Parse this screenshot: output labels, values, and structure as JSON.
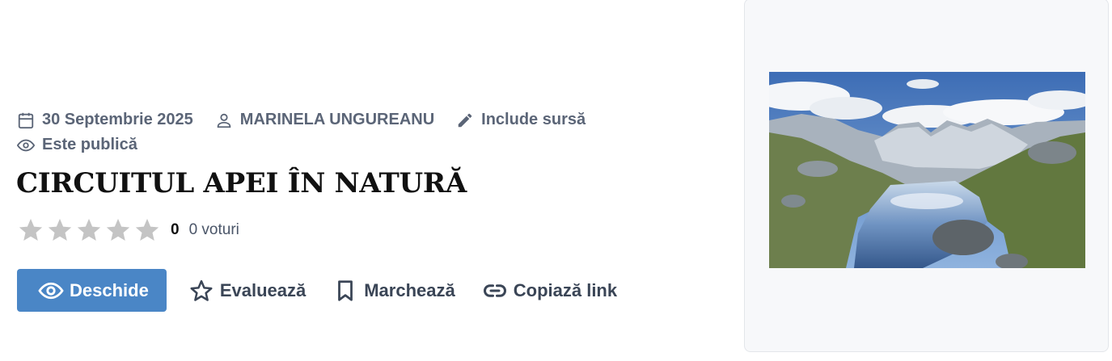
{
  "meta": {
    "date": "30 Septembrie 2025",
    "author": "MARINELA UNGUREANU",
    "source": "Include sursă",
    "visibility": "Este publică"
  },
  "title": "CIRCUITUL APEI ÎN NATURĂ",
  "rating": {
    "score": "0",
    "votes": "0 voturi",
    "stars_filled": 0,
    "stars_total": 5
  },
  "actions": {
    "open": "Deschide",
    "rate": "Evaluează",
    "bookmark": "Marchează",
    "copy_link": "Copiază link"
  },
  "colors": {
    "primary": "#4a86c6",
    "meta_text": "#5b6577",
    "star_empty": "#c4c4c4",
    "panel_bg": "#f7f8fa"
  },
  "icons": {
    "date": "calendar-icon",
    "author": "user-icon",
    "source": "pencil-icon",
    "visibility": "eye-icon",
    "open": "eye-icon",
    "rate": "star-outline-icon",
    "bookmark": "bookmark-icon",
    "copy_link": "link-icon"
  }
}
